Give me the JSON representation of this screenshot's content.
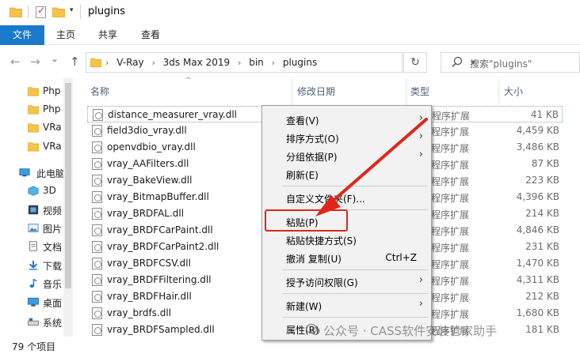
{
  "window": {
    "title": "plugins",
    "quick_access_dropdown": "▾"
  },
  "ribbon": {
    "file_tab": "文件",
    "tabs": [
      "主页",
      "共享",
      "查看"
    ]
  },
  "nav": {
    "back": "←",
    "forward": "→",
    "dropdown": "⌄",
    "up": "↑",
    "breadcrumb": [
      "V-Ray",
      "3ds Max 2019",
      "bin",
      "plugins"
    ],
    "search_placeholder": "搜索\"plugins\""
  },
  "navpane": {
    "items": [
      {
        "label": "Php",
        "icon": "folder-icon"
      },
      {
        "label": "Php",
        "icon": "folder-icon"
      },
      {
        "label": "VRa",
        "icon": "folder-icon"
      },
      {
        "label": "VRa",
        "icon": "folder-icon"
      },
      {
        "label": "此电脑",
        "icon": "pc-icon"
      },
      {
        "label": "3D",
        "icon": "3d-objects-icon"
      },
      {
        "label": "视频",
        "icon": "videos-icon"
      },
      {
        "label": "图片",
        "icon": "pictures-icon"
      },
      {
        "label": "文档",
        "icon": "documents-icon"
      },
      {
        "label": "下载",
        "icon": "downloads-icon"
      },
      {
        "label": "音乐",
        "icon": "music-icon"
      },
      {
        "label": "桌面",
        "icon": "desktop-icon"
      },
      {
        "label": "系统",
        "icon": "drive-icon"
      }
    ]
  },
  "columns": {
    "name": "名称",
    "modified": "修改日期",
    "type": "类型",
    "size": "大小"
  },
  "files": [
    {
      "name": "distance_measurer_vray.dll",
      "type": "程序扩展",
      "size": "41 KB"
    },
    {
      "name": "field3dio_vray.dll",
      "type": "程序扩展",
      "size": "4,459 KB"
    },
    {
      "name": "openvdbio_vray.dll",
      "type": "程序扩展",
      "size": "3,486 KB"
    },
    {
      "name": "vray_AAFilters.dll",
      "type": "程序扩展",
      "size": "87 KB"
    },
    {
      "name": "vray_BakeView.dll",
      "type": "程序扩展",
      "size": "223 KB"
    },
    {
      "name": "vray_BitmapBuffer.dll",
      "type": "程序扩展",
      "size": "4,396 KB"
    },
    {
      "name": "vray_BRDFAL.dll",
      "type": "程序扩展",
      "size": "214 KB"
    },
    {
      "name": "vray_BRDFCarPaint.dll",
      "type": "程序扩展",
      "size": "4,846 KB"
    },
    {
      "name": "vray_BRDFCarPaint2.dll",
      "type": "程序扩展",
      "size": "231 KB"
    },
    {
      "name": "vray_BRDFCSV.dll",
      "type": "程序扩展",
      "size": "1,470 KB"
    },
    {
      "name": "vray_BRDFFiltering.dll",
      "type": "程序扩展",
      "size": "4,311 KB"
    },
    {
      "name": "vray_BRDFHair.dll",
      "type": "程序扩展",
      "size": "212 KB"
    },
    {
      "name": "vray_brdfs.dll",
      "type": "程序扩展",
      "size": "1,680 KB"
    },
    {
      "name": "vray_BRDFSampled.dll",
      "type": "程序扩展",
      "size": "181 KB"
    }
  ],
  "status": {
    "count_text": "79 个项目"
  },
  "context_menu": {
    "view": "查看(V)",
    "sort": "排序方式(O)",
    "group": "分组依据(P)",
    "refresh": "刷新(E)",
    "customize": "自定义文件夹(F)...",
    "paste": "粘贴(P)",
    "paste_shortcut": "粘贴快捷方式(S)",
    "undo": "撤消 复制(U)",
    "undo_shortcut": "Ctrl+Z",
    "grant_access": "授予访问权限(G)",
    "new": "新建(W)",
    "properties": "属性(R)"
  },
  "watermark": {
    "text": "公众号 · CASS软件安装管家助手",
    "corner_text": "79 个项目"
  },
  "colors": {
    "accent": "#1979ca",
    "annotation_red": "#e0261b",
    "folder_yellow": "#f3c34a"
  }
}
